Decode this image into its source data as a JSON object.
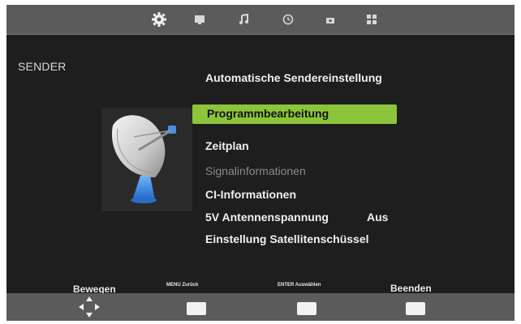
{
  "topbar": {
    "tabs": [
      {
        "name": "tab-settings",
        "icon": "gear-icon"
      },
      {
        "name": "tab-picture",
        "icon": "monitor-icon"
      },
      {
        "name": "tab-sound",
        "icon": "music-note-icon"
      },
      {
        "name": "tab-time",
        "icon": "clock-icon"
      },
      {
        "name": "tab-lock",
        "icon": "lock-icon"
      },
      {
        "name": "tab-setup",
        "icon": "grid-icon"
      }
    ],
    "active_icon_color": "#f0f0f0"
  },
  "section": {
    "title": "SENDER"
  },
  "menu": {
    "items": [
      {
        "label": "Automatische Sendereinstellung"
      },
      {
        "label": "Programmbearbeitung",
        "selected": true
      },
      {
        "label": "Zeitplan"
      },
      {
        "label": "Signalinformationen",
        "disabled": true
      },
      {
        "label": "CI-Informationen"
      },
      {
        "label": "5V Antennenspannung",
        "value": "Aus"
      },
      {
        "label": "Einstellung Satellitenschüssel"
      }
    ],
    "selected_color": "#8cc43a"
  },
  "footer": {
    "move_label": "Bewegen",
    "back_label": "MENU Zurück",
    "select_label": "ENTER Auswählen",
    "exit_label": "Beenden"
  }
}
